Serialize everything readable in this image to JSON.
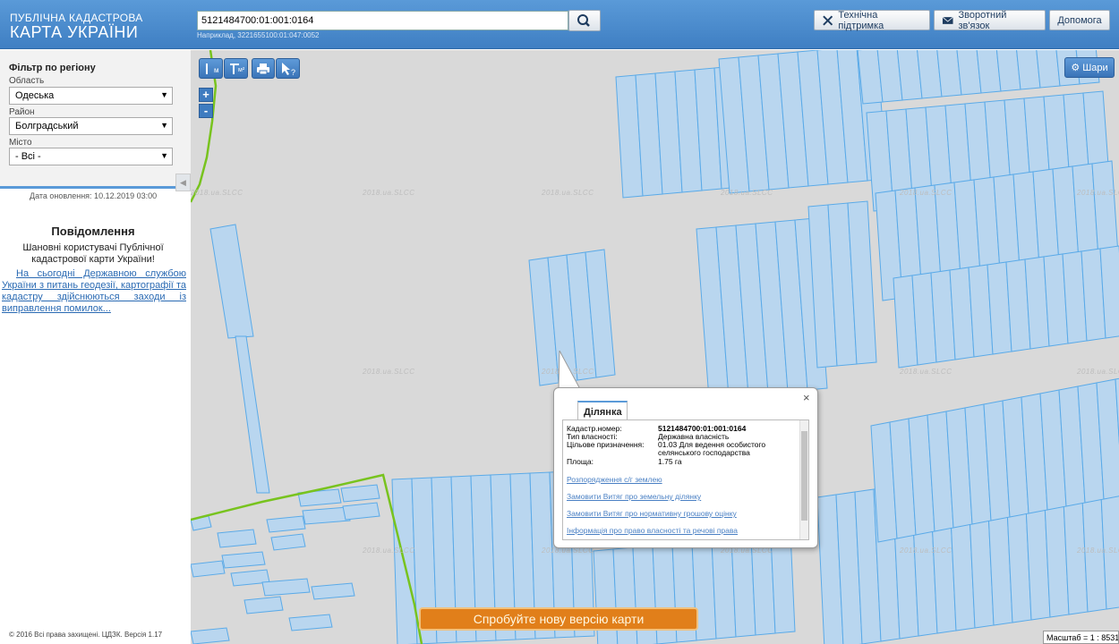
{
  "header": {
    "logo_line1": "ПУБЛІЧНА КАДАСТРОВА",
    "logo_line2": "КАРТА УКРАЇНИ",
    "search_value": "5121484700:01:001:0164",
    "search_hint": "Наприклад, 3221655100:01:047:0052",
    "support_label": "Технічна підтримка",
    "feedback_label": "Зворотний зв'язок",
    "help_label": "Допомога"
  },
  "sidebar": {
    "filter_title": "Фільтр по регіону",
    "region_label": "Область",
    "region_value": "Одеська",
    "district_label": "Район",
    "district_value": "Болградський",
    "city_label": "Місто",
    "city_value": "- Всі -",
    "update_date": "Дата оновлення: 10.12.2019 03:00",
    "notice_title": "Повідомлення",
    "notice_text": "Шановні користувачі Публічної кадастрової карти України!",
    "notice_link": "На сьогодні Державною службою України з питань геодезії, картографії та кадастру здійснюються заходи із виправлення помилок...",
    "copyright": "© 2016 Всі права захищені. ЦДЗК. Версія 1.17"
  },
  "map": {
    "tool_measure_label": "м",
    "tool_area_label": "м²",
    "zoom_in": "+",
    "zoom_out": "-",
    "layers_label": "Шари",
    "watermark": "2018.ua.SLCC",
    "new_version_label": "Спробуйте нову версію карти",
    "scale_label": "Масштаб = 1 : 8531",
    "colors": {
      "parcel_fill": "#b9d6ef",
      "parcel_stroke": "#5aaae8",
      "boundary_line": "#78c31e",
      "map_bg": "#d9d9d9"
    }
  },
  "popup": {
    "tab_label": "Ділянка",
    "close": "×",
    "cadastr_label": "Кадастр.номер:",
    "cadastr_value": "5121484700:01:001:0164",
    "ownership_label": "Тип власності:",
    "ownership_value": "Державна власність",
    "purpose_label": "Цільове призначення:",
    "purpose_value": "01.03 Для ведення особистого селянського господарства",
    "area_label": "Площа:",
    "area_value": "1.75 га",
    "link1": "Розпорядження с/г землею",
    "link2": "Замовити Витяг про земельну ділянку",
    "link3": "Замовити Витяг про нормативну грошову оцінку",
    "link4": "Інформація про право власності та речові права"
  }
}
